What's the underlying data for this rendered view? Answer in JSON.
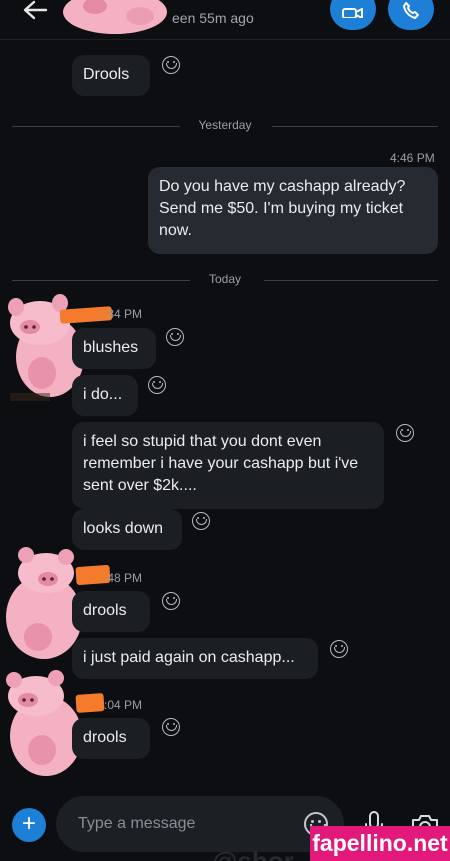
{
  "header": {
    "status": "een 55m ago",
    "back_icon": "back-arrow-icon",
    "video_icon": "video-call-icon",
    "call_icon": "phone-call-icon",
    "accent": "#1d7fd6"
  },
  "messages": {
    "m0": "Drools",
    "divider_yesterday": "Yesterday",
    "time_446": "4:46 PM",
    "out1": "Do you have my cashapp already? Send me $50. I'm buying my ticket now.",
    "divider_today": "Today",
    "time_a": ":34 PM",
    "m1": "blushes",
    "m2": "i do...",
    "m3": "i feel so stupid that you dont even remember i have your cashapp but i've sent over $2k....",
    "m4": "looks down",
    "time_b": ":48 PM",
    "m5": "drools",
    "m6": "i just paid again on cashapp...",
    "time_c": ":04 PM",
    "m7": "drools"
  },
  "composer": {
    "placeholder": "Type a message",
    "plus_label": "+",
    "emoji_icon": "emoji-icon",
    "mic_icon": "microphone-icon",
    "camera_icon": "camera-icon"
  },
  "watermark": "fapellino.net",
  "bottom_peek": "@shor"
}
